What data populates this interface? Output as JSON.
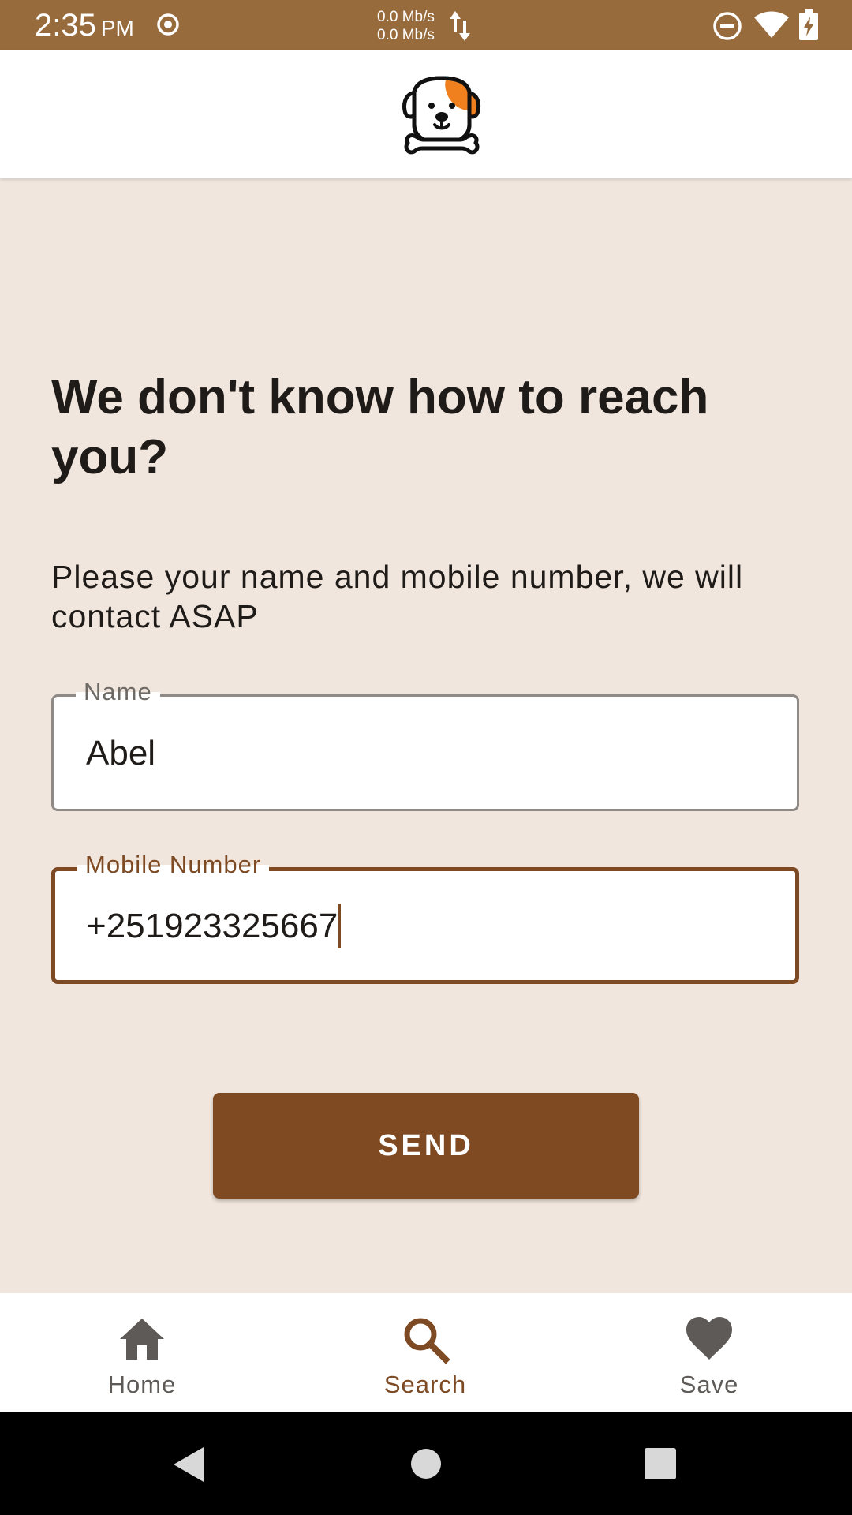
{
  "status_bar": {
    "time": "2:35",
    "ampm": "PM",
    "net_up": "0.0 Mb/s",
    "net_down": "0.0 Mb/s",
    "icons": [
      "record-icon",
      "data-arrows-icon",
      "do-not-disturb-icon",
      "wifi-icon",
      "battery-charging-icon"
    ]
  },
  "app_bar": {
    "logo": "dog-with-bone-logo"
  },
  "main": {
    "title": "We don't know how to reach you?",
    "subtitle": "Please your name and mobile number, we will contact ASAP",
    "name_field": {
      "label": "Name",
      "value": "Abel"
    },
    "mobile_field": {
      "label": "Mobile Number",
      "value": "+251923325667"
    },
    "send_label": "SEND"
  },
  "bottom_nav": {
    "items": [
      {
        "label": "Home",
        "icon": "home-icon",
        "active": false
      },
      {
        "label": "Search",
        "icon": "search-icon",
        "active": true
      },
      {
        "label": "Save",
        "icon": "heart-icon",
        "active": false
      }
    ]
  },
  "colors": {
    "status_bar": "#986b3c",
    "background": "#f1e6de",
    "accent": "#7f4a22",
    "logo_orange": "#f07f1e"
  }
}
